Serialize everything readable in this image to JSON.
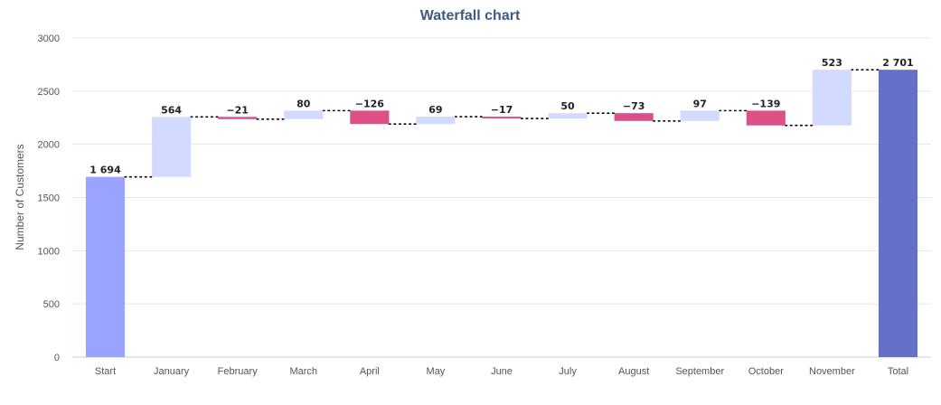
{
  "chart_data": {
    "type": "waterfall",
    "title": "Waterfall chart",
    "ylabel": "Number of Customers",
    "xlabel": "",
    "ylim": [
      0,
      3000
    ],
    "yticks": [
      0,
      500,
      1000,
      1500,
      2000,
      2500,
      3000
    ],
    "grid": true,
    "categories": [
      "Start",
      "January",
      "February",
      "March",
      "April",
      "May",
      "June",
      "July",
      "August",
      "September",
      "October",
      "November",
      "Total"
    ],
    "values": [
      1694,
      564,
      -21,
      80,
      -126,
      69,
      -17,
      50,
      -73,
      97,
      -139,
      523,
      2701
    ],
    "labels": [
      "1 694",
      "564",
      "−21",
      "80",
      "−126",
      "69",
      "−17",
      "50",
      "−73",
      "97",
      "−139",
      "523",
      "2 701"
    ],
    "kinds": [
      "total",
      "delta",
      "delta",
      "delta",
      "delta",
      "delta",
      "delta",
      "delta",
      "delta",
      "delta",
      "delta",
      "delta",
      "total"
    ],
    "colors": {
      "start": "#9aa3ff",
      "increase": "#d3daff",
      "decrease": "#dc4f87",
      "total": "#6571c8",
      "title": "#3d5a80",
      "grid": "#e6e6e6",
      "connector": "#000000"
    }
  }
}
